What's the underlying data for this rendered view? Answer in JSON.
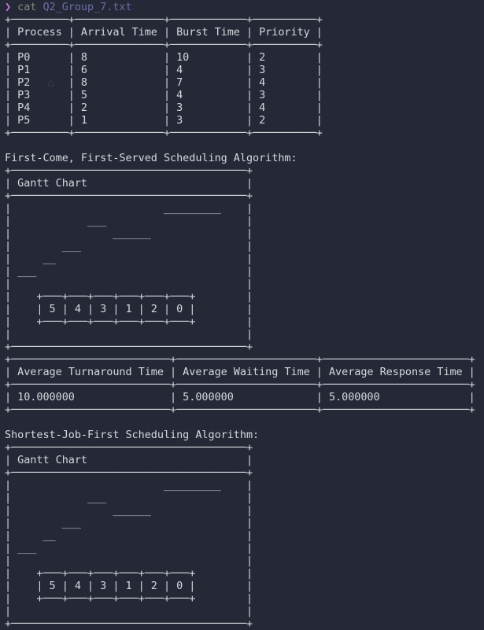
{
  "prompt": {
    "symbol": "❯",
    "command": "cat",
    "argument": "Q2_Group_7.txt"
  },
  "lines": [
    "+─────────+──────────────+────────────+──────────+",
    "| Process | Arrival Time | Burst Time | Priority |",
    "+─────────+──────────────+────────────+──────────+",
    "| P0      | 8            | 10         | 2        |",
    "| P1      | 6            | 4          | 3        |",
    "| P2      | 8            | 7          | 4        |",
    "| P3      | 5            | 4          | 3        |",
    "| P4      | 2            | 3          | 4        |",
    "| P5      | 1            | 3          | 2        |",
    "+─────────+──────────────+────────────+──────────+",
    "",
    "First-Come, First-Served Scheduling Algorithm:",
    "+─────────────────────────────────────+",
    "| Gantt Chart                         |",
    "+─────────────────────────────────────+",
    "|                        _________    |",
    "|            ___                      |",
    "|                ______               |",
    "|        ___                          |",
    "|     __                              |",
    "| ___                                 |",
    "|                                     |",
    "|    +───+───+───+───+───+───+        |",
    "|    | 5 | 4 | 3 | 1 | 2 | 0 |        |",
    "|    +───+───+───+───+───+───+        |",
    "|                                     |",
    "+─────────────────────────────────────+",
    "+─────────────────────────+──────────────────────+───────────────────────+",
    "| Average Turnaround Time | Average Waiting Time | Average Response Time |",
    "+─────────────────────────+──────────────────────+───────────────────────+",
    "| 10.000000               | 5.000000             | 5.000000              |",
    "+─────────────────────────+──────────────────────+───────────────────────+",
    "",
    "Shortest-Job-First Scheduling Algorithm:",
    "+─────────────────────────────────────+",
    "| Gantt Chart                         |",
    "+─────────────────────────────────────+",
    "|                        _________    |",
    "|            ___                      |",
    "|                ______               |",
    "|        ___                          |",
    "|     __                              |",
    "| ___                                 |",
    "|                                     |",
    "|    +───+───+───+───+───+───+        |",
    "|    | 5 | 4 | 3 | 1 | 2 | 0 |        |",
    "|    +───+───+───+───+───+───+        |",
    "|                                     |",
    "+─────────────────────────────────────+"
  ]
}
